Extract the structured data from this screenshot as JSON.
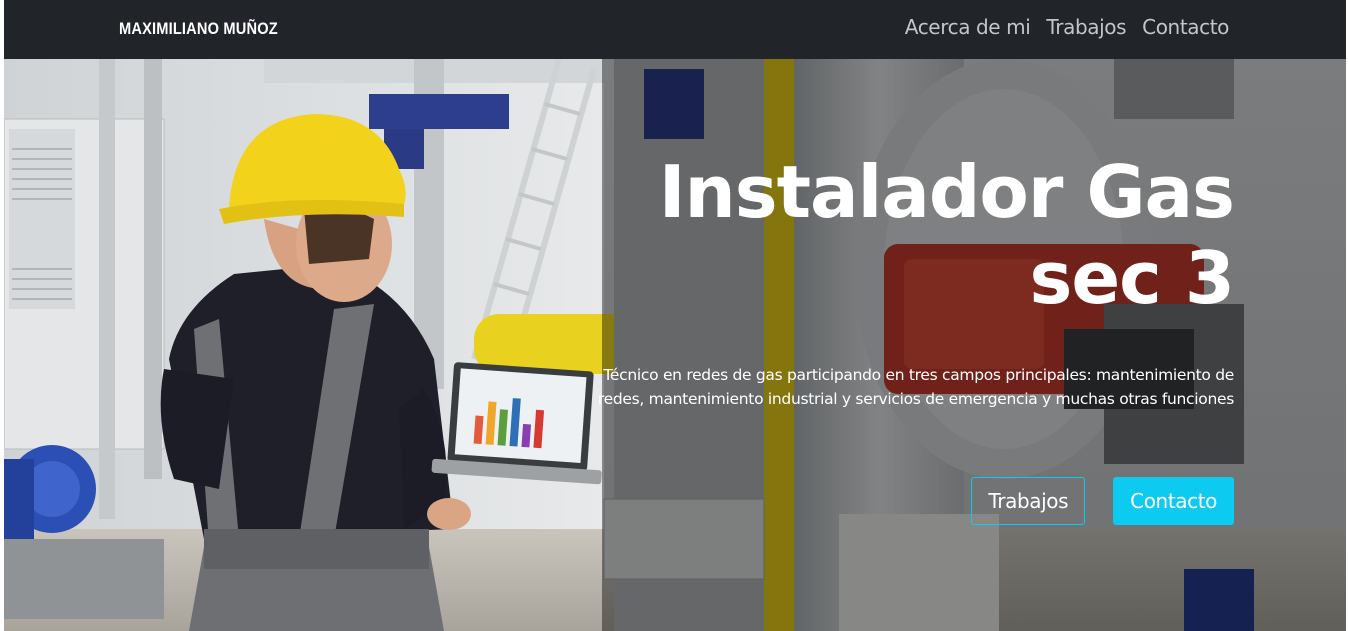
{
  "navbar": {
    "brand": "MAXIMILIANO MUÑOZ",
    "links": [
      "Acerca de mi",
      "Trabajos",
      "Contacto"
    ]
  },
  "hero": {
    "title_line1": "Instalador Gas",
    "title_line2": "sec 3",
    "description": "Técnico en redes de gas participando en tres campos principales: mantenimiento de redes, mantenimiento industrial y servicios de emergencia y muchas otras funciones",
    "buttons": {
      "primary": "Trabajos",
      "secondary": "Contacto"
    },
    "image": "gas-technician-photo"
  },
  "colors": {
    "navbar_bg": "#212529",
    "accent": "#0dcaf0",
    "hard_hat": "#f2d21b"
  }
}
